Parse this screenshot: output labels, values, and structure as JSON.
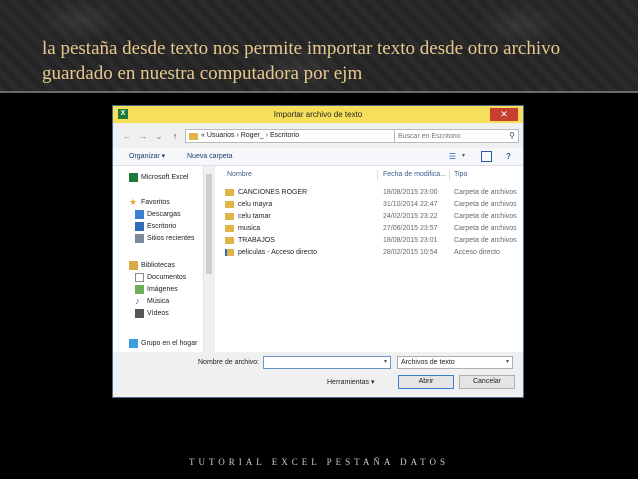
{
  "slide": {
    "title": "la pestaña desde texto nos permite importar texto desde otro archivo guardado en nuestra computadora  por ejm",
    "footer": "TUTORIAL EXCEL PESTAÑA DATOS",
    "colors": {
      "title": "#e8c98f",
      "background": "#000000",
      "titlebar": "#f6e05a",
      "close": "#c7402f"
    }
  },
  "dialog": {
    "title": "Importar archivo de texto",
    "app_icon": "excel-icon",
    "close_glyph": "✕",
    "address": {
      "prefix": "«",
      "crumbs": [
        "Usuarios",
        "Roger_",
        "Escritorio"
      ],
      "separator": "›"
    },
    "search_placeholder": "Buscar en Escritorio",
    "toolbar": {
      "organize": "Organizar ▾",
      "new_folder": "Nueva carpeta"
    },
    "nav": [
      {
        "label": "Microsoft Excel",
        "icon": "excel-icon"
      },
      {
        "label": "Favoritos",
        "icon": "star-icon"
      },
      {
        "label": "Descargas",
        "icon": "downloads-icon"
      },
      {
        "label": "Escritorio",
        "icon": "desktop-icon"
      },
      {
        "label": "Sitios recientes",
        "icon": "recent-icon"
      },
      {
        "label": "Bibliotecas",
        "icon": "libraries-icon"
      },
      {
        "label": "Documentos",
        "icon": "documents-icon"
      },
      {
        "label": "Imágenes",
        "icon": "images-icon"
      },
      {
        "label": "Música",
        "icon": "music-icon"
      },
      {
        "label": "Vídeos",
        "icon": "videos-icon"
      },
      {
        "label": "Grupo en el hogar",
        "icon": "homegroup-icon"
      }
    ],
    "columns": {
      "name": "Nombre",
      "date": "Fecha de modifica...",
      "type": "Tipo"
    },
    "files": [
      {
        "name": "CANCIONES ROGER",
        "date": "18/08/2015 23:00",
        "type": "Carpeta de archivos"
      },
      {
        "name": "celu mayra",
        "date": "31/10/2014 22:47",
        "type": "Carpeta de archivos"
      },
      {
        "name": "celu tamar",
        "date": "24/02/2015 23:22",
        "type": "Carpeta de archivos"
      },
      {
        "name": "musica",
        "date": "27/06/2015 23:57",
        "type": "Carpeta de archivos"
      },
      {
        "name": "TRABAJOS",
        "date": "18/08/2015 23:01",
        "type": "Carpeta de archivos"
      },
      {
        "name": "peliculas - Acceso directo",
        "date": "28/02/2015 10:54",
        "type": "Acceso directo"
      }
    ],
    "filename_label": "Nombre de archivo:",
    "filename_value": "",
    "filetype_value": "Archivos de texto",
    "tools_label": "Herramientas",
    "open_label": "Abrir",
    "cancel_label": "Cancelar"
  }
}
